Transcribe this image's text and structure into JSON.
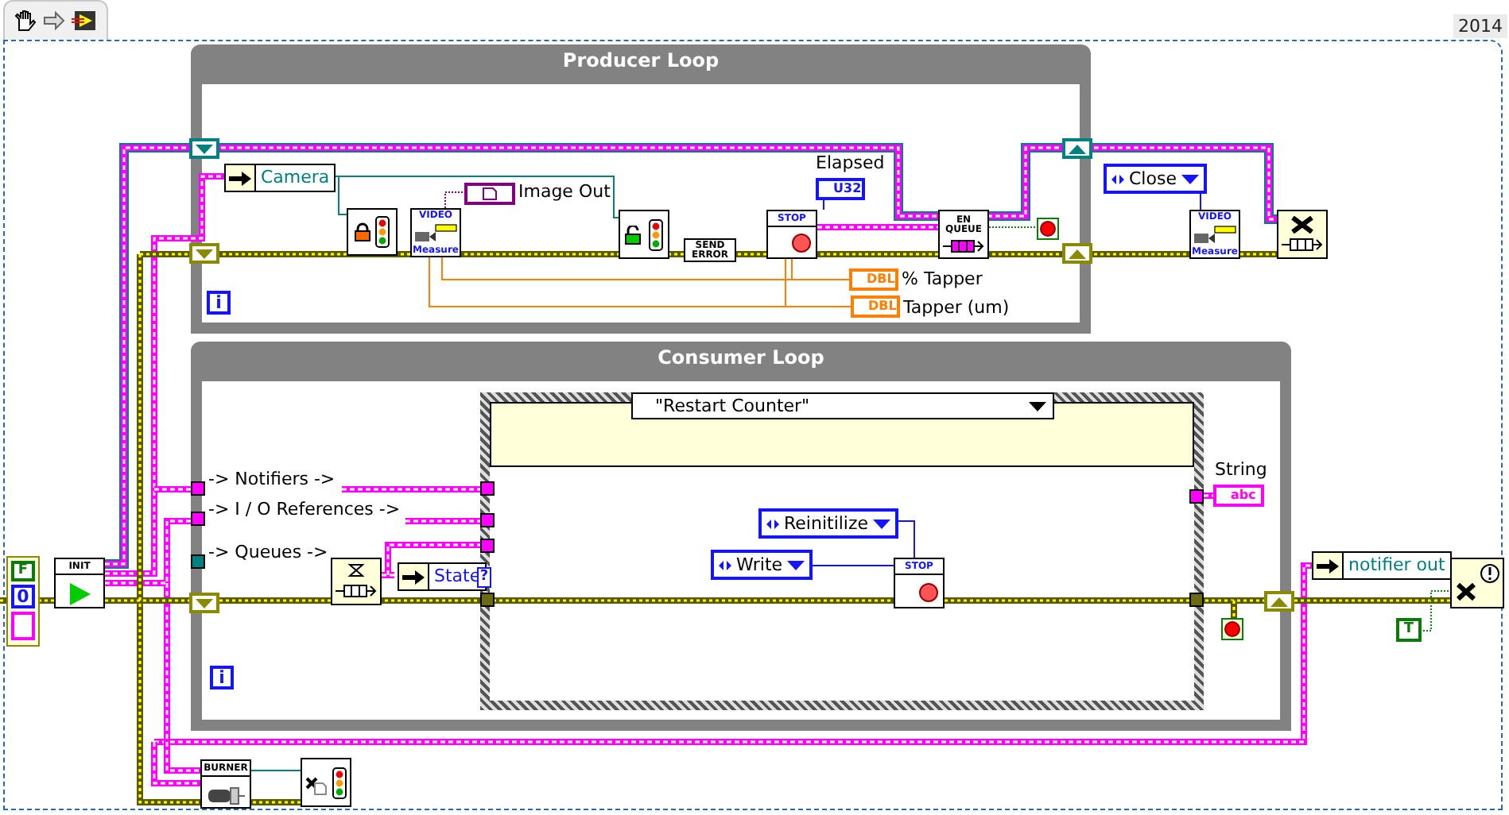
{
  "toolbar": {
    "version": "2014"
  },
  "init_node": {
    "header": "INIT"
  },
  "cluster_constant": {
    "boolean": "F",
    "number": "0"
  },
  "producer_loop": {
    "title": "Producer Loop",
    "iteration": "i",
    "camera": "Camera",
    "image_out": "Image Out",
    "video_node": {
      "header": "VIDEO",
      "footer": "Measure"
    },
    "send_error": "SEND ERROR",
    "stop_node": "STOP",
    "elapsed": {
      "label": "Elapsed",
      "type": "U32"
    },
    "enqueue": "EN QUEUE",
    "tapper_percent": {
      "label": "% Tapper",
      "type": "DBL"
    },
    "tapper_um": {
      "label": "Tapper (um)",
      "type": "DBL"
    }
  },
  "close_enum": "Close",
  "close_video_node": {
    "header": "VIDEO",
    "footer": "Measure"
  },
  "consumer_loop": {
    "title": "Consumer Loop",
    "iteration": "i",
    "inputs": [
      {
        "label": "-> Notifiers ->",
        "kind": "ref"
      },
      {
        "label": "-> I / O References ->",
        "kind": "ref"
      },
      {
        "label": "-> Queues ->",
        "kind": "queue"
      }
    ],
    "state": "State",
    "selector_terminal": "?",
    "case_selector": "\"Restart Counter\"",
    "reinitilize": "Reinitilize",
    "write": "Write",
    "stop_node": "STOP",
    "string": {
      "label": "String",
      "type": "abc"
    }
  },
  "notifier_out": "notifier out",
  "true_constant": "T",
  "burner_node": "BURNER"
}
